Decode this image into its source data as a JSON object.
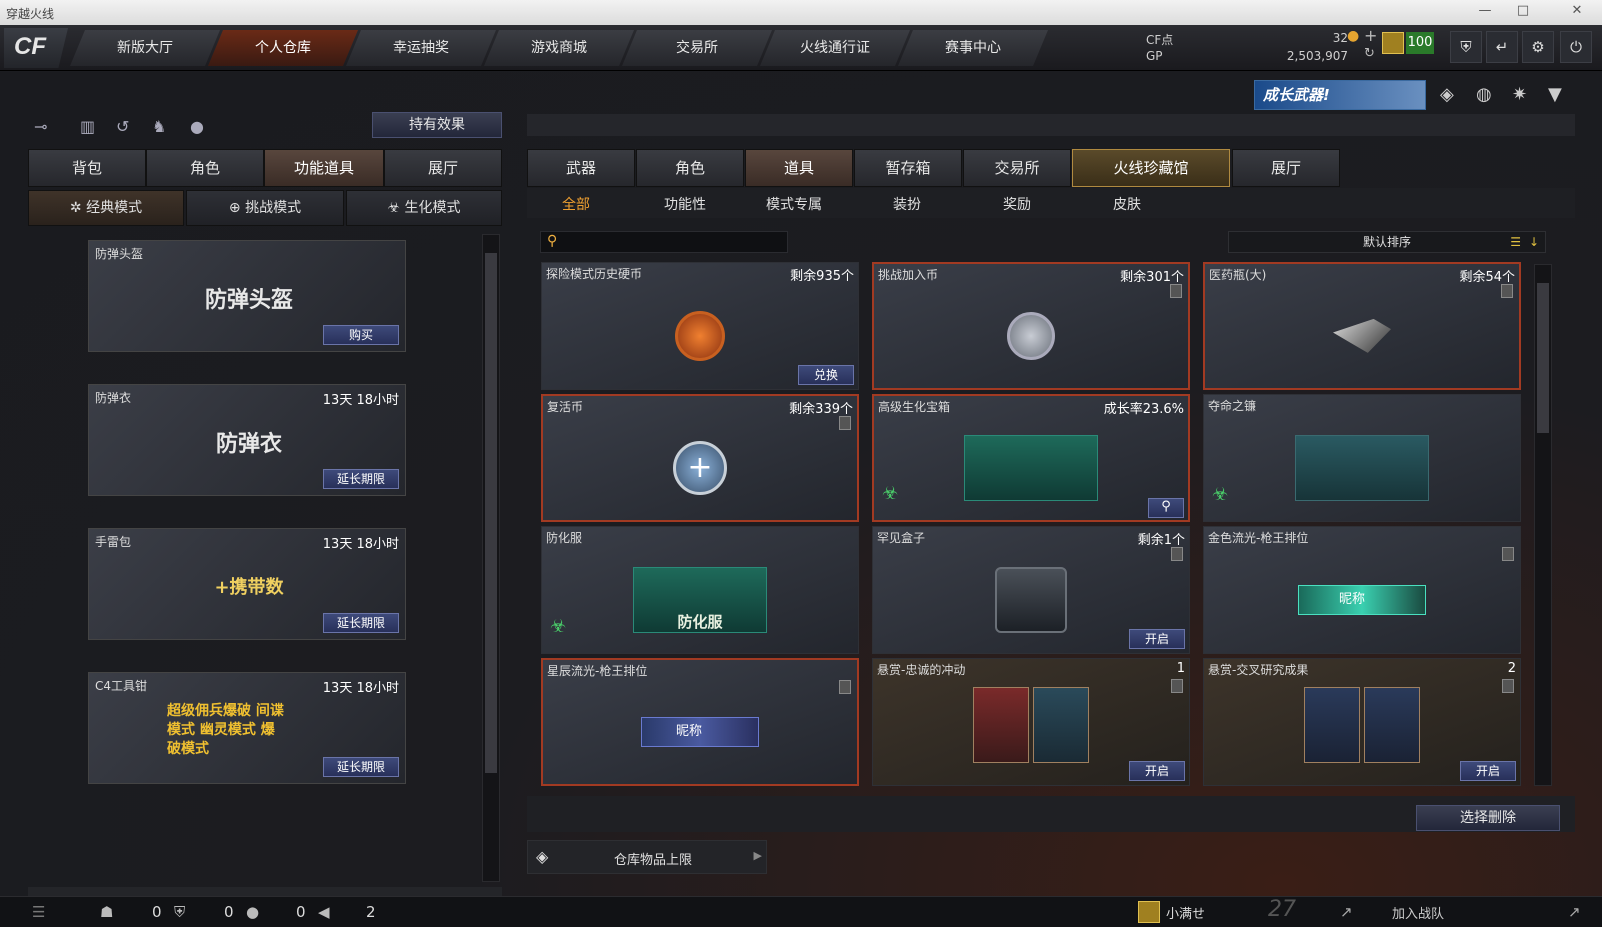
{
  "window": {
    "title": "穿越火线",
    "minimize": "—",
    "maximize": "□",
    "close": "✕"
  },
  "logo": "CF",
  "nav": [
    "新版大厅",
    "个人仓库",
    "幸运抽奖",
    "游戏商城",
    "交易所",
    "火线通行证",
    "赛事中心"
  ],
  "nav_active": 1,
  "currency": {
    "cf_label": "CF点",
    "cf_value": "32",
    "gp_label": "GP",
    "gp_value": "2,503,907",
    "level": "100"
  },
  "banner": "成长武器!",
  "left": {
    "effects_button": "持有效果",
    "tabs": [
      "背包",
      "角色",
      "功能道具",
      "展厅"
    ],
    "active_tab": 2,
    "modes": [
      "经典模式",
      "挑战模式",
      "生化模式"
    ],
    "items": [
      {
        "name": "防弹头盔",
        "time": "",
        "art": "防弹头盔",
        "action": "购买"
      },
      {
        "name": "防弹衣",
        "time": "13天 18小时",
        "art": "防弹衣",
        "action": "延长期限"
      },
      {
        "name": "手雷包",
        "time": "13天 18小时",
        "art": "+携带数",
        "action": "延长期限"
      },
      {
        "name": "C4工具钳",
        "time": "13天 18小时",
        "art": "超级佣兵爆破 间谍模式 幽灵模式 爆破模式",
        "action": "延长期限"
      }
    ]
  },
  "right": {
    "tabs": [
      "武器",
      "角色",
      "道具",
      "暂存箱",
      "交易所",
      "火线珍藏馆",
      "展厅"
    ],
    "active_tab": 2,
    "filters": [
      "全部",
      "功能性",
      "模式专属",
      "装扮",
      "奖励",
      "皮肤"
    ],
    "sort_label": "默认排序",
    "items": [
      {
        "name": "探险模式历史硬币",
        "right": "剩余935个",
        "action": "兑换"
      },
      {
        "name": "挑战加入币",
        "right": "剩余301个",
        "action": ""
      },
      {
        "name": "医药瓶(大)",
        "right": "剩余54个",
        "action": ""
      },
      {
        "name": "复活币",
        "right": "剩余339个",
        "action": ""
      },
      {
        "name": "高级生化宝箱",
        "right": "成长率23.6%",
        "action": ""
      },
      {
        "name": "夺命之镰",
        "right": "",
        "action": ""
      },
      {
        "name": "防化服",
        "right": "",
        "action": "",
        "art": "防化服"
      },
      {
        "name": "罕见盒子",
        "right": "剩余1个",
        "action": "开启"
      },
      {
        "name": "金色流光-枪王排位",
        "right": "",
        "action": "",
        "art": "昵称"
      },
      {
        "name": "星辰流光-枪王排位",
        "right": "",
        "action": "",
        "art": "昵称"
      },
      {
        "name": "悬赏-忠诚的冲动",
        "right": "1",
        "action": "开启"
      },
      {
        "name": "悬赏-交叉研究成果",
        "right": "2",
        "action": "开启"
      }
    ],
    "select_delete": "选择删除",
    "storage_limit": "仓库物品上限"
  },
  "bottom": {
    "count1": "0",
    "count2": "0",
    "count3": "0",
    "count4": "2",
    "player": "小满せ",
    "season": "27",
    "join_team": "加入战队"
  }
}
